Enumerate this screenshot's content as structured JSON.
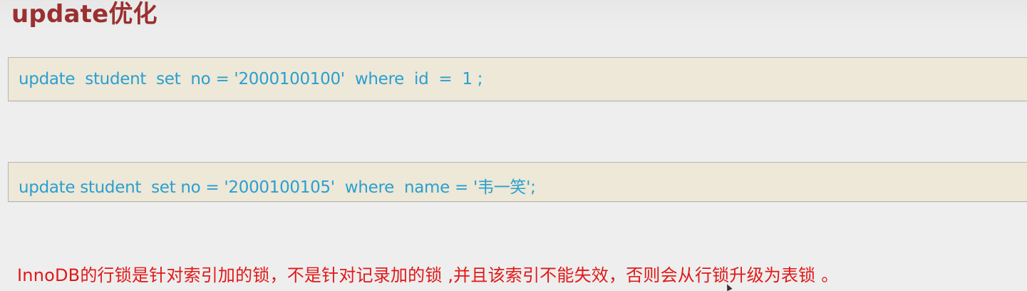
{
  "slide": {
    "title": "update优化",
    "queries": [
      {
        "text": "update  student  set  no = '2000100100'  where  id  =  1 ;"
      },
      {
        "text": "update student  set no = '2000100105'  where  name = '韦一笑';"
      }
    ],
    "note": "InnoDB的行锁是针对索引加的锁，不是针对记录加的锁 ,并且该索引不能失效，否则会从行锁升级为表锁 。"
  },
  "colors": {
    "title": "#9a3030",
    "code_text": "#2a9fd0",
    "code_box_bg": "#ede8d7",
    "note_text": "#e01818",
    "background": "#eeeeee"
  },
  "icons": {
    "cursor": "mouse-pointer-icon"
  }
}
